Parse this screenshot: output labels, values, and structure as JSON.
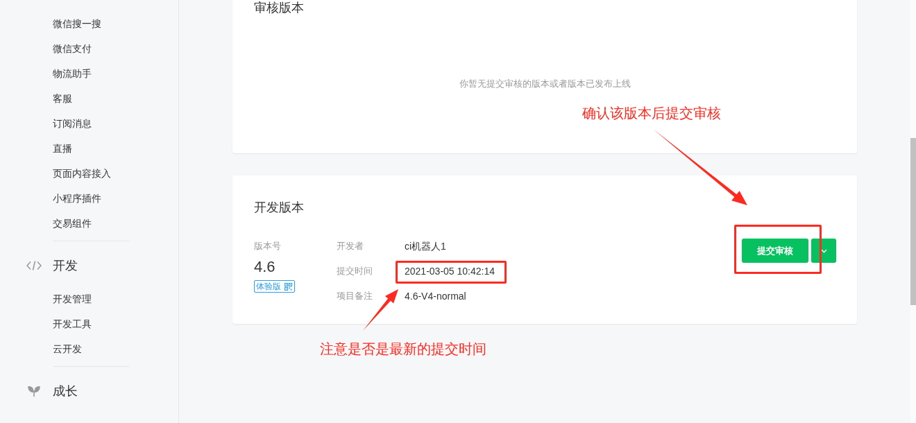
{
  "sidebar": {
    "sections": [
      {
        "items": [
          {
            "label": "微信搜一搜",
            "selected": false
          },
          {
            "label": "微信支付",
            "selected": false
          },
          {
            "label": "物流助手",
            "selected": false
          },
          {
            "label": "客服",
            "selected": false
          },
          {
            "label": "订阅消息",
            "selected": false
          },
          {
            "label": "直播",
            "selected": false
          },
          {
            "label": "页面内容接入",
            "selected": false
          },
          {
            "label": "小程序插件",
            "selected": false
          },
          {
            "label": "交易组件",
            "selected": false
          }
        ]
      },
      {
        "title": "开发",
        "items": [
          {
            "label": "开发管理",
            "selected": false
          },
          {
            "label": "开发工具",
            "selected": false
          },
          {
            "label": "云开发",
            "selected": false
          }
        ]
      },
      {
        "title": "成长"
      }
    ]
  },
  "review_version": {
    "title": "审核版本",
    "empty_text": "你暂无提交审核的版本或者版本已发布上线"
  },
  "dev_version": {
    "title": "开发版本",
    "version_label": "版本号",
    "version": "4.6",
    "badge": "体验版",
    "fields": [
      {
        "label": "开发者",
        "value": "ci机器人1"
      },
      {
        "label": "提交时间",
        "value": "2021-03-05 10:42:14"
      },
      {
        "label": "项目备注",
        "value": "4.6-V4-normal"
      }
    ],
    "primary_button": "提交审核"
  },
  "annotations": [
    {
      "text": "确认该版本后提交审核"
    },
    {
      "text": "注意是否是最新的提交时间"
    }
  ]
}
